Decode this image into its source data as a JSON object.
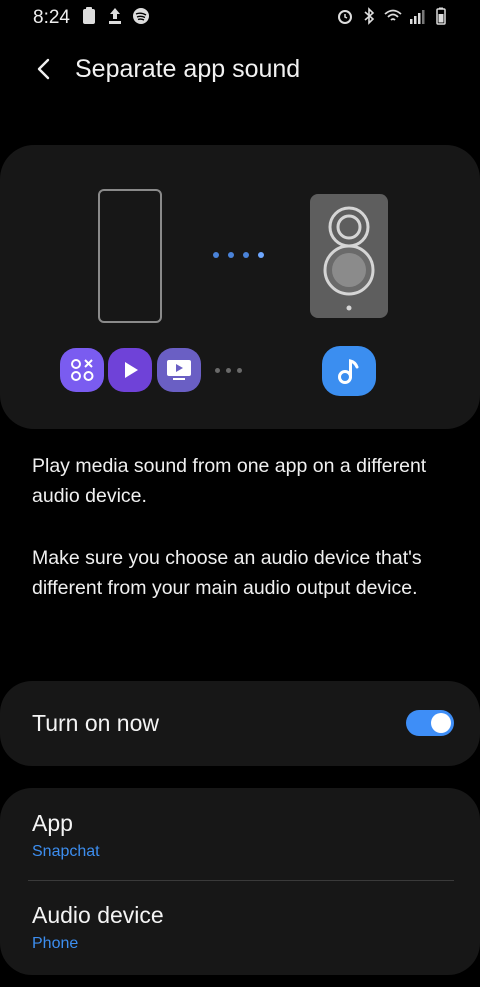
{
  "status_bar": {
    "time": "8:24",
    "left_icons": [
      "clipboard-icon",
      "upload-icon",
      "spotify-icon"
    ],
    "right_icons": [
      "alarm-icon",
      "bluetooth-icon",
      "wifi-icon",
      "signal-icon",
      "battery-icon"
    ]
  },
  "header": {
    "title": "Separate app sound",
    "back_icon": "chevron-left-icon"
  },
  "illustration": {
    "left_device": "phone-outline-icon",
    "right_device": "speaker-icon",
    "source_apps": [
      "apps-grid-icon",
      "play-icon",
      "tv-icon"
    ],
    "target_app": "music-note-icon",
    "colors": {
      "accent": "#3e8ef7",
      "app1": "#7a5cf0",
      "app2": "#6f42d8",
      "app3": "#6a5fc4",
      "music": "#3b8ef0"
    }
  },
  "description": {
    "para1": "Play media sound from one app on a different audio device.",
    "para2": "Make sure you choose an audio device that's different from your main audio output device."
  },
  "toggle": {
    "label": "Turn on now",
    "state": "on"
  },
  "settings": {
    "app": {
      "title": "App",
      "value": "Snapchat"
    },
    "audio_device": {
      "title": "Audio device",
      "value": "Phone"
    }
  }
}
